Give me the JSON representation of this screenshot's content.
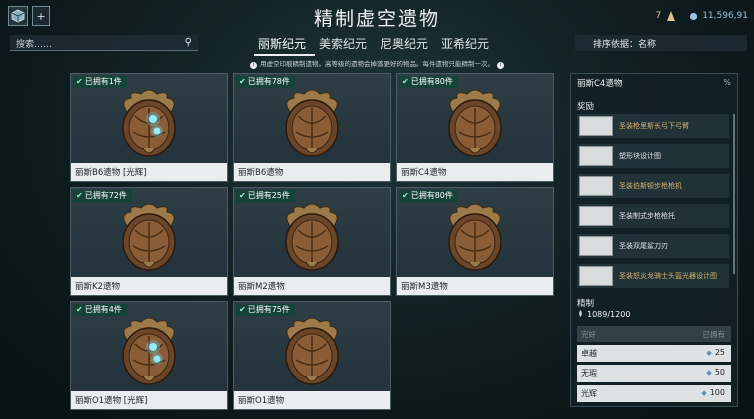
{
  "title": "精制虚空遗物",
  "header": {
    "currency_count": "7",
    "platinum": "11,596,91",
    "plus_label": "+"
  },
  "search": {
    "placeholder": "搜索……"
  },
  "tabs": [
    {
      "label": "丽斯纪元",
      "active": true
    },
    {
      "label": "美索纪元",
      "active": false
    },
    {
      "label": "尼奥纪元",
      "active": false
    },
    {
      "label": "亚希纪元",
      "active": false
    }
  ],
  "sort": {
    "label": "排序依据：名称"
  },
  "notice": "用虚空印痕精制遗物。高等级的遗物会掉落更好的物品。每件遗物只能精制一次。",
  "relics": [
    {
      "owned": "已拥有1件",
      "name": "丽斯B6遗物 [光辉]",
      "glow": true
    },
    {
      "owned": "已拥有78件",
      "name": "丽斯B6遗物",
      "glow": false
    },
    {
      "owned": "已拥有80件",
      "name": "丽斯C4遗物",
      "glow": false
    },
    {
      "owned": "已拥有72件",
      "name": "丽斯K2遗物",
      "glow": false
    },
    {
      "owned": "已拥有25件",
      "name": "丽斯M2遗物",
      "glow": false
    },
    {
      "owned": "已拥有80件",
      "name": "丽斯M3遗物",
      "glow": false
    },
    {
      "owned": "已拥有4件",
      "name": "丽斯O1遗物 [光辉]",
      "glow": true
    },
    {
      "owned": "已拥有75件",
      "name": "丽斯O1遗物",
      "glow": false
    }
  ],
  "panel": {
    "title": "丽斯C4遗物",
    "pct_icon": "%",
    "rewards_label": "奖励",
    "rewards": [
      {
        "name": "圣装枪里斯长弓下弓臂",
        "color": "#d4b06a"
      },
      {
        "name": "塑形块设计图",
        "color": "#dde3e6"
      },
      {
        "name": "圣装伯斯顿步枪枪机",
        "color": "#d4b06a"
      },
      {
        "name": "圣装制式步枪枪托",
        "color": "#dde3e6"
      },
      {
        "name": "圣装双尾鲨刀刃",
        "color": "#dde3e6"
      },
      {
        "name": "圣装怒炎龙骑士头盔光器设计图",
        "color": "#d4b06a"
      }
    ],
    "refine_label": "精制",
    "traces": "1089/1200",
    "tier_header": {
      "left": "完好",
      "right": "已拥有"
    },
    "tiers": [
      {
        "name": "卓越",
        "cost": "25"
      },
      {
        "name": "无瑕",
        "cost": "50"
      },
      {
        "name": "光辉",
        "cost": "100"
      }
    ]
  }
}
